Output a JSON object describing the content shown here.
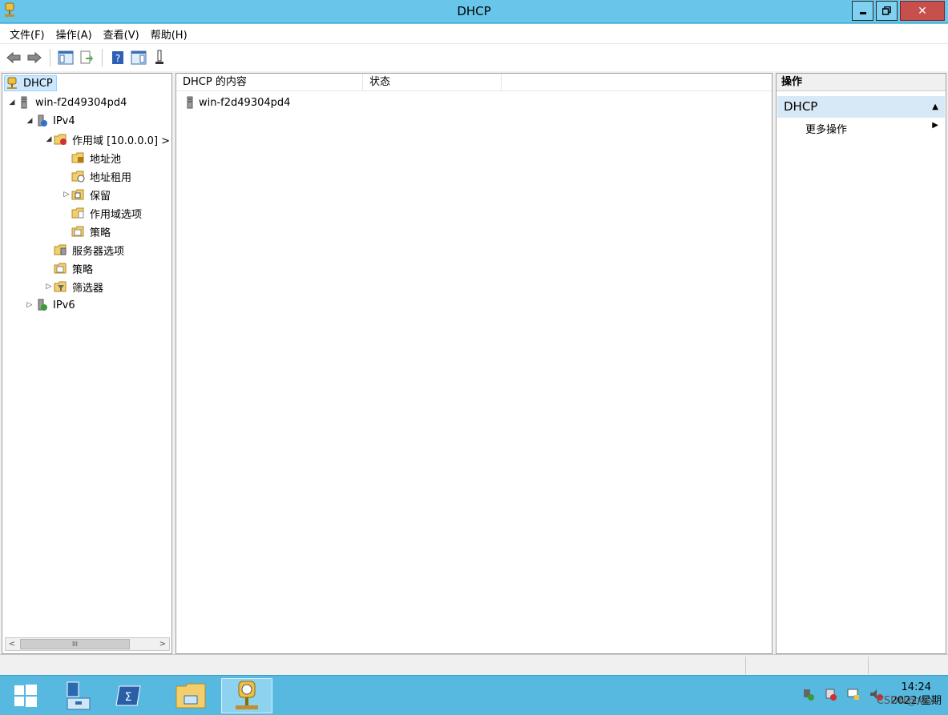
{
  "window": {
    "title": "DHCP"
  },
  "menu": [
    "文件(F)",
    "操作(A)",
    "查看(V)",
    "帮助(H)"
  ],
  "tree": {
    "root": "DHCP",
    "server": "win-f2d49304pd4",
    "ipv4": "IPv4",
    "scope": "作用域 [10.0.0.0] >",
    "address_pool": "地址池",
    "address_leases": "地址租用",
    "reservations": "保留",
    "scope_options": "作用域选项",
    "scope_policies": "策略",
    "server_options": "服务器选项",
    "policies": "策略",
    "filters": "筛选器",
    "ipv6": "IPv6"
  },
  "list": {
    "columns": [
      "DHCP 的内容",
      "状态"
    ],
    "rows": [
      {
        "name": "win-f2d49304pd4",
        "status": ""
      }
    ]
  },
  "actions": {
    "header": "操作",
    "group": "DHCP",
    "more": "更多操作"
  },
  "taskbar": {
    "time": "14:24",
    "date": "2022/星期",
    "watermark": "CSDN@xxx"
  }
}
